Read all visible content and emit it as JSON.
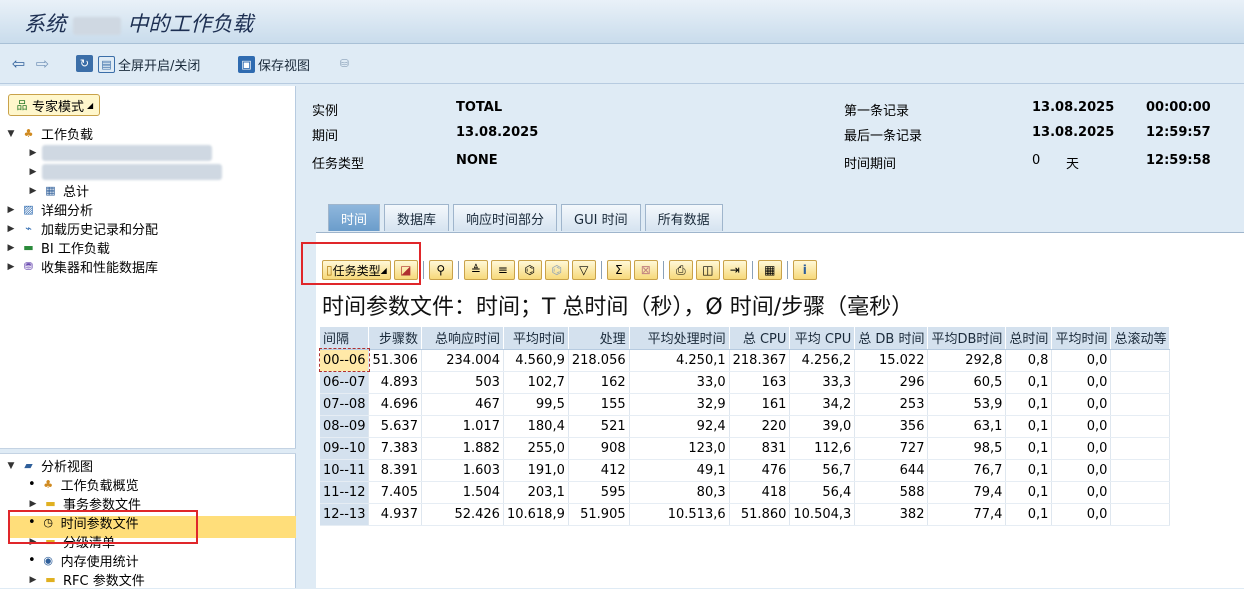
{
  "window": {
    "title_prefix": "系统",
    "title_suffix": "中的工作负载"
  },
  "toolbar": {
    "fullscreen": "全屏开启/关闭",
    "save_view": "保存视图"
  },
  "left": {
    "expert_mode": "专家模式",
    "workload": "工作负载",
    "total": "总计",
    "detail_analysis": "详细分析",
    "load_history": "加载历史记录和分配",
    "bi_workload": "BI 工作负载",
    "collector": "收集器和性能数据库",
    "analysis_view": "分析视图",
    "views": [
      "工作负载概览",
      "事务参数文件",
      "时间参数文件",
      "分级清单",
      "内存使用统计",
      "RFC 参数文件"
    ]
  },
  "header": {
    "instance_label": "实例",
    "instance_value": "TOTAL",
    "period_label": "期间",
    "period_value": "13.08.2025",
    "task_type_label": "任务类型",
    "task_type_value": "NONE",
    "first_record_label": "第一条记录",
    "first_record_date": "13.08.2025",
    "first_record_time": "00:00:00",
    "last_record_label": "最后一条记录",
    "last_record_date": "13.08.2025",
    "last_record_time": "12:59:57",
    "time_period_label": "时间期间",
    "time_period_days": "0",
    "days_unit": "天",
    "time_period_time": "12:59:58"
  },
  "tabs": [
    "时间",
    "数据库",
    "响应时间部分",
    "GUI 时间",
    "所有数据"
  ],
  "grid": {
    "task_type_button": "任务类型",
    "title": "时间参数文件：时间；T 总时间（秒），Ø 时间/步骤（毫秒）",
    "columns": [
      "间隔",
      "步骤数",
      "总响应时间",
      "平均时间",
      "处理",
      "平均处理时间",
      "总 CPU",
      "平均 CPU",
      "总 DB 时间",
      "平均DB时间",
      "总时间",
      "平均时间",
      "总滚动等"
    ],
    "rows": [
      [
        "00--06",
        "51.306",
        "234.004",
        "4.560,9",
        "218.056",
        "4.250,1",
        "218.367",
        "4.256,2",
        "15.022",
        "292,8",
        "0,8",
        "0,0",
        ""
      ],
      [
        "06--07",
        "4.893",
        "503",
        "102,7",
        "162",
        "33,0",
        "163",
        "33,3",
        "296",
        "60,5",
        "0,1",
        "0,0",
        ""
      ],
      [
        "07--08",
        "4.696",
        "467",
        "99,5",
        "155",
        "32,9",
        "161",
        "34,2",
        "253",
        "53,9",
        "0,1",
        "0,0",
        ""
      ],
      [
        "08--09",
        "5.637",
        "1.017",
        "180,4",
        "521",
        "92,4",
        "220",
        "39,0",
        "356",
        "63,1",
        "0,1",
        "0,0",
        ""
      ],
      [
        "09--10",
        "7.383",
        "1.882",
        "255,0",
        "908",
        "123,0",
        "831",
        "112,6",
        "727",
        "98,5",
        "0,1",
        "0,0",
        ""
      ],
      [
        "10--11",
        "8.391",
        "1.603",
        "191,0",
        "412",
        "49,1",
        "476",
        "56,7",
        "644",
        "76,7",
        "0,1",
        "0,0",
        ""
      ],
      [
        "11--12",
        "7.405",
        "1.504",
        "203,1",
        "595",
        "80,3",
        "418",
        "56,4",
        "588",
        "79,4",
        "0,1",
        "0,0",
        ""
      ],
      [
        "12--13",
        "4.937",
        "52.426",
        "10.618,9",
        "51.905",
        "10.513,6",
        "51.860",
        "10.504,3",
        "382",
        "77,4",
        "0,1",
        "0,0",
        ""
      ]
    ]
  }
}
